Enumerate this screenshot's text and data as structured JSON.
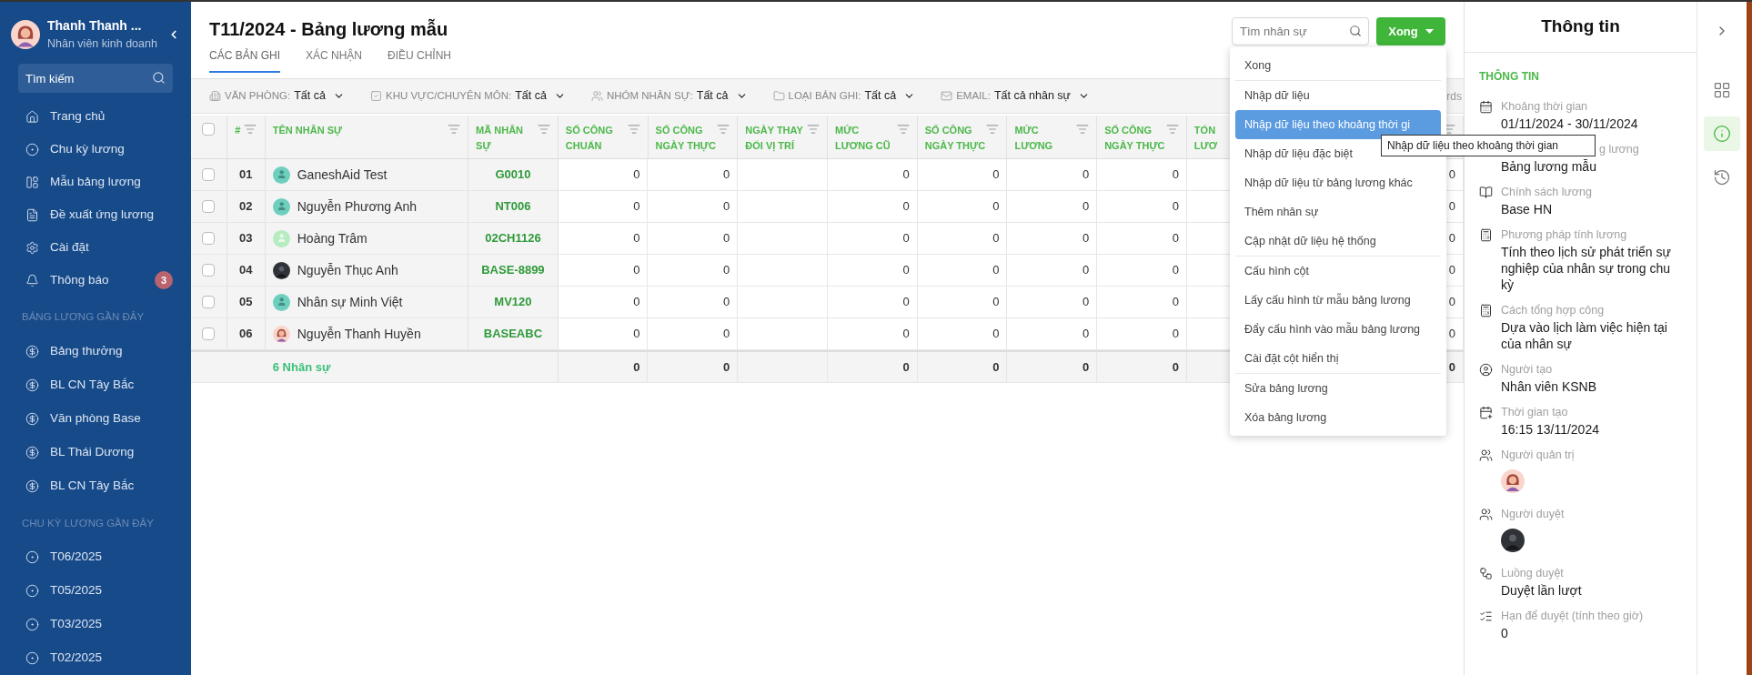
{
  "user": {
    "name": "Thanh Thanh ...",
    "role": "Nhân viên kinh doanh"
  },
  "sidebar": {
    "search": {
      "placeholder": "Tìm kiếm"
    },
    "items": [
      {
        "label": "Trang chủ"
      },
      {
        "label": "Chu kỳ lương"
      },
      {
        "label": "Mẫu bảng lương"
      },
      {
        "label": "Đề xuất ứng lương"
      },
      {
        "label": "Cài đặt"
      },
      {
        "label": "Thông báo",
        "badge": "3"
      }
    ],
    "sections": [
      {
        "title": "BẢNG LƯƠNG GẦN ĐÂY",
        "items": [
          "Bảng thưởng",
          "BL CN Tây Bắc",
          "Văn phòng Base",
          "BL Thái Dương",
          "BL CN Tây Bắc"
        ]
      },
      {
        "title": "CHU KỲ LƯƠNG GẦN ĐÂY",
        "items": [
          "T06/2025",
          "T05/2025",
          "T03/2025",
          "T02/2025"
        ]
      }
    ]
  },
  "page": {
    "title": "T11/2024 - Bảng lương mẫu",
    "tabs": [
      {
        "label": "CÁC BẢN GHI",
        "selected": true
      },
      {
        "label": "XÁC NHẬN",
        "selected": false
      },
      {
        "label": "ĐIỀU CHỈNH",
        "selected": false
      }
    ],
    "search": {
      "placeholder": "Tìm nhân sự"
    },
    "action_button": "Xong",
    "filters": [
      {
        "label": "VĂN PHÒNG:",
        "value": "Tất cả"
      },
      {
        "label": "KHU VỰC/CHUYÊN MÔN:",
        "value": "Tất cả"
      },
      {
        "label": "NHÓM NHÂN SỰ:",
        "value": "Tất cả"
      },
      {
        "label": "LOẠI BẢN GHI:",
        "value": "Tất cả"
      },
      {
        "label": "EMAIL:",
        "value": "Tất cả nhân sự"
      }
    ],
    "filter_bar_text": "rds"
  },
  "table": {
    "all_checked": false,
    "columns": [
      {
        "kind": "index",
        "label": "#"
      },
      {
        "kind": "name",
        "label": "TÊN NHÂN SỰ"
      },
      {
        "kind": "code",
        "label": "MÃ NHÂN SỰ"
      },
      {
        "kind": "number",
        "label": "SỐ CÔNG CHUẨN"
      },
      {
        "kind": "number",
        "label": "SỐ CÔNG NGÀY THỰC"
      },
      {
        "kind": "blank",
        "label": "NGÀY THAY ĐỔI VỊ TRÍ"
      },
      {
        "kind": "number",
        "label": "MỨC LƯƠNG CŨ"
      },
      {
        "kind": "number",
        "label": "SỐ CÔNG NGÀY THỰC"
      },
      {
        "kind": "number",
        "label": "MỨC LƯƠNG"
      },
      {
        "kind": "number",
        "label": "SỐ CÔNG NGÀY THỰC"
      },
      {
        "kind": "covered",
        "label": "TỔN LƯƠ"
      },
      {
        "kind": "number"
      }
    ],
    "rows": [
      {
        "index": "01",
        "name": "GaneshAid Test",
        "kind": "default",
        "code": "G0010",
        "checked": false,
        "values": [
          "0",
          "0",
          "0",
          "0",
          "0",
          "0",
          "0"
        ]
      },
      {
        "index": "02",
        "name": "Nguyễn Phương Anh",
        "kind": "default",
        "code": "NT006",
        "checked": false,
        "values": [
          "0",
          "0",
          "0",
          "0",
          "0",
          "0",
          "0"
        ]
      },
      {
        "index": "03",
        "name": "Hoàng Trâm",
        "kind": "light",
        "code": "02CH1126",
        "checked": false,
        "values": [
          "0",
          "0",
          "0",
          "0",
          "0",
          "0",
          "0"
        ]
      },
      {
        "index": "04",
        "name": "Nguyễn Thục Anh",
        "kind": "dark",
        "code": "BASE-8899",
        "checked": false,
        "values": [
          "0",
          "0",
          "0",
          "0",
          "0",
          "0",
          "0"
        ]
      },
      {
        "index": "05",
        "name": "Nhân sự Minh Việt",
        "kind": "default",
        "code": "MV120",
        "checked": false,
        "values": [
          "0",
          "0",
          "0",
          "0",
          "0",
          "0",
          "0"
        ]
      },
      {
        "index": "06",
        "name": "Nguyễn Thanh Huyền",
        "kind": "woman",
        "code": "BASEABC",
        "checked": false,
        "values": [
          "0",
          "0",
          "0",
          "0",
          "0",
          "0",
          "0"
        ]
      }
    ],
    "footer": {
      "label": "6 Nhân sự",
      "values": [
        "0",
        "0",
        "0",
        "0",
        "0",
        "0",
        "0"
      ]
    }
  },
  "dropdown": {
    "groups": [
      [
        {
          "label": "Xong",
          "selected": false
        }
      ],
      [
        {
          "label": "Nhập dữ liệu",
          "selected": false
        },
        {
          "label": "Nhập dữ liệu theo khoảng thời gi",
          "selected": true
        },
        {
          "label": "Nhập dữ liệu đặc biệt",
          "selected": false
        },
        {
          "label": "Nhập dữ liệu từ bảng lương khác",
          "selected": false
        },
        {
          "label": "Thêm nhân sự",
          "selected": false
        },
        {
          "label": "Cập nhật dữ liệu hệ thống",
          "selected": false
        }
      ],
      [
        {
          "label": "Cấu hình cột",
          "selected": false
        },
        {
          "label": "Lấy cấu hình từ mẫu bảng lương",
          "selected": false
        },
        {
          "label": "Đẩy cấu hình vào mẫu bảng lương",
          "selected": false
        },
        {
          "label": "Cài đặt cột hiển thị",
          "selected": false
        }
      ],
      [
        {
          "label": "Sửa bảng lương",
          "selected": false
        },
        {
          "label": "Xóa bảng lương",
          "selected": false
        }
      ]
    ],
    "tooltip": "Nhập dữ liệu theo khoảng thời gian"
  },
  "info_panel": {
    "title": "Thông tin",
    "section": "THÔNG TIN",
    "items": [
      {
        "kind": "text",
        "label": "Khoảng thời gian",
        "value": "01/11/2024 - 30/11/2024"
      },
      {
        "kind": "covered",
        "label": "g lương",
        "value": "Bảng lương mẫu"
      },
      {
        "kind": "text",
        "label": "Chính sách lương",
        "value": "Base HN"
      },
      {
        "kind": "text",
        "label": "Phương pháp tính lương",
        "value": "Tính theo lịch sử phát triển sự nghiệp của nhân sự trong chu kỳ"
      },
      {
        "kind": "text",
        "label": "Cách tổng hợp công",
        "value": "Dựa vào lịch làm việc hiện tại của nhân sự"
      },
      {
        "kind": "text",
        "label": "Người tạo",
        "value": "Nhân viên KSNB"
      },
      {
        "kind": "text",
        "label": "Thời gian tạo",
        "value": "16:15 13/11/2024"
      },
      {
        "kind": "person",
        "label": "Người quản trị"
      },
      {
        "kind": "person",
        "label": "Người duyệt"
      },
      {
        "kind": "text",
        "label": "Luồng duyệt",
        "value": "Duyệt lần lượt"
      },
      {
        "kind": "text",
        "label": "Hạn để duyệt (tính theo giờ)",
        "value": "0"
      }
    ]
  },
  "side_strip": [
    {
      "selected": false
    },
    {
      "selected": true
    },
    {
      "selected": false
    }
  ]
}
